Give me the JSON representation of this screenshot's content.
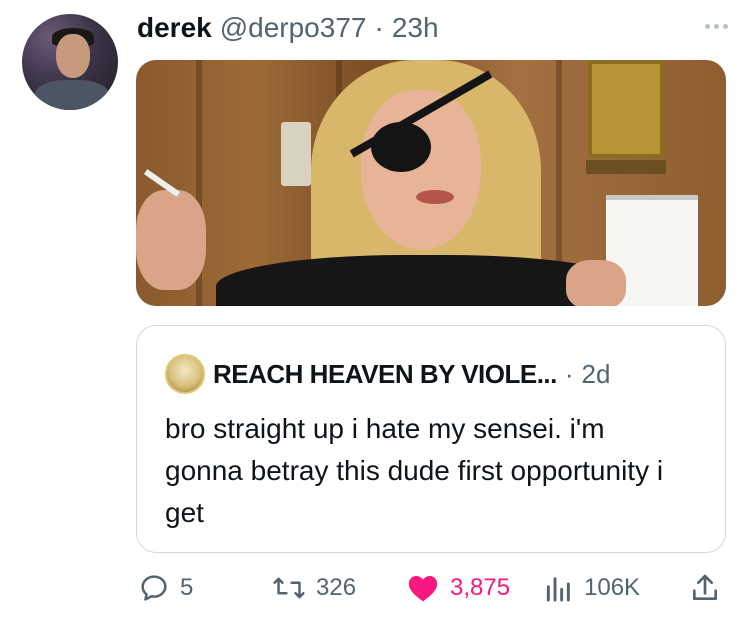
{
  "tweet": {
    "display_name": "derek",
    "handle": "@derpo377",
    "separator": "·",
    "time": "23h"
  },
  "quoted": {
    "display_name": "REACH HEAVEN BY VIOLE...",
    "separator": "·",
    "time": "2d",
    "text": "bro straight up i hate my sensei. i'm gonna betray this dude first opportunity i get"
  },
  "actions": {
    "replies": "5",
    "retweets": "326",
    "likes": "3,875",
    "views": "106K"
  },
  "icons": {
    "more": "more-horizontal-icon",
    "reply": "reply-icon",
    "retweet": "retweet-icon",
    "like": "heart-icon",
    "views": "views-icon",
    "share": "share-icon"
  },
  "colors": {
    "like": "#f91880",
    "muted": "#536471",
    "border": "#cfd9de"
  }
}
